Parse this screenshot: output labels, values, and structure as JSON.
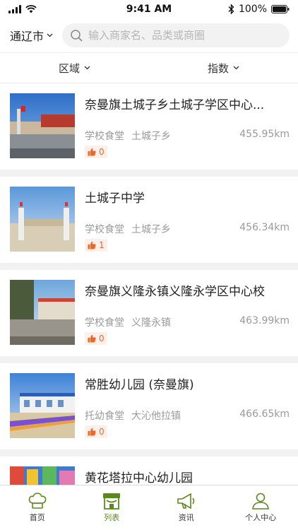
{
  "status_bar": {
    "time": "9:41 AM",
    "battery": "100%"
  },
  "header": {
    "city": "通辽市",
    "search_placeholder": "输入商家名、品类或商圈"
  },
  "filters": [
    {
      "label": "区域"
    },
    {
      "label": "指数"
    }
  ],
  "listings": [
    {
      "name": "奈曼旗土城子乡土城子学区中心...",
      "category": "学校食堂",
      "area": "土城子乡",
      "distance": "455.95km",
      "likes": "0"
    },
    {
      "name": "土城子中学",
      "category": "学校食堂",
      "area": "土城子乡",
      "distance": "456.34km",
      "likes": "1"
    },
    {
      "name": "奈曼旗义隆永镇义隆永学区中心校",
      "category": "学校食堂",
      "area": "义隆永镇",
      "distance": "463.99km",
      "likes": "0"
    },
    {
      "name": "常胜幼儿园 (奈曼旗)",
      "category": "托幼食堂",
      "area": "大沁他拉镇",
      "distance": "466.65km",
      "likes": "0"
    },
    {
      "name": "黄花塔拉中心幼儿园",
      "category": "",
      "area": "",
      "distance": "",
      "likes": ""
    }
  ],
  "tabbar": [
    {
      "label": "首页",
      "icon": "chef-hat-icon"
    },
    {
      "label": "列表",
      "icon": "storefront-icon",
      "active": true
    },
    {
      "label": "资讯",
      "icon": "megaphone-icon"
    },
    {
      "label": "个人中心",
      "icon": "person-icon"
    }
  ],
  "colors": {
    "accent": "#5a8a1e",
    "like": "#e8692e",
    "background": "#f2f2f2"
  }
}
